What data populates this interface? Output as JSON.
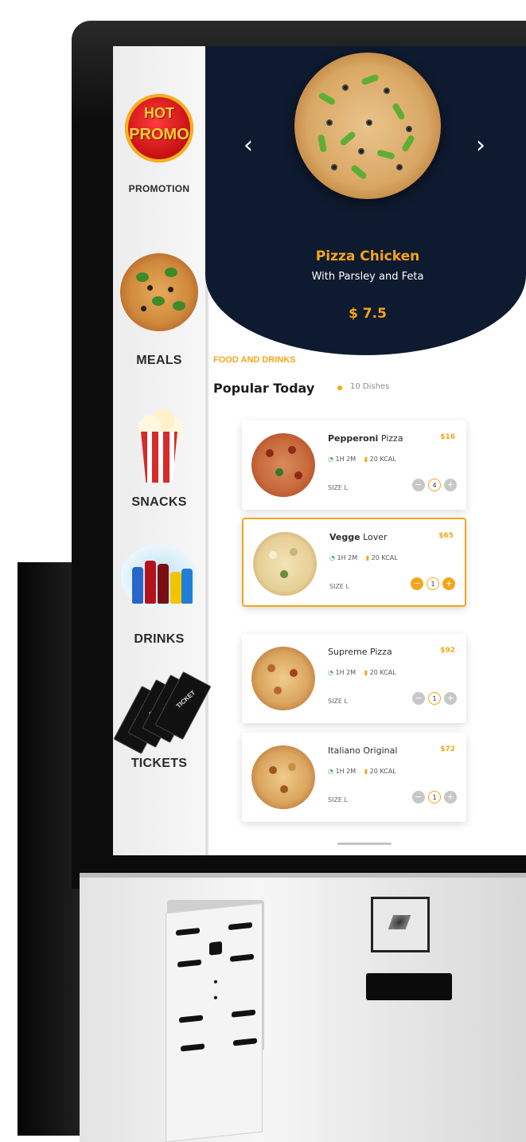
{
  "sidebar": {
    "promo_badge": [
      "HOT",
      "PROMO"
    ],
    "items": [
      {
        "label": "PROMOTION"
      },
      {
        "label": "MEALS"
      },
      {
        "label": "SNACKS"
      },
      {
        "label": "DRINKS"
      },
      {
        "label": "TICKETS"
      }
    ],
    "ticket_text": "TICKET"
  },
  "hero": {
    "title": "Pizza Chicken",
    "subtitle": "With Parsley and Feta",
    "price": "$ 7.5",
    "prev_icon": "‹",
    "next_icon": "›"
  },
  "listing": {
    "eyebrow": "FOOD AND DRINKS",
    "title": "Popular Today",
    "count": "10 Dishes",
    "items": [
      {
        "name_bold": "Pepperoni",
        "name_rest": " Pizza",
        "price": "$16",
        "time": "1H 2M",
        "kcal": "20 KCAL",
        "size": "SIZE L",
        "qty": "4",
        "selected": false
      },
      {
        "name_bold": "Vegge",
        "name_rest": " Lover",
        "price": "$65",
        "time": "1H 2M",
        "kcal": "20 KCAL",
        "size": "SIZE L",
        "qty": "1",
        "selected": true
      },
      {
        "name_bold": "",
        "name_rest": "Supreme Pizza",
        "price": "$92",
        "time": "1H 2M",
        "kcal": "20 KCAL",
        "size": "SIZE L",
        "qty": "1",
        "selected": false
      },
      {
        "name_bold": "",
        "name_rest": "Italiano Original",
        "price": "$72",
        "time": "1H 2M",
        "kcal": "20 KCAL",
        "size": "SIZE L",
        "qty": "1",
        "selected": false
      }
    ]
  },
  "colors": {
    "accent": "#f6a51a",
    "hero_bg": "#0e1a2f",
    "time_icon": "#3aa055"
  },
  "icons": {
    "clock": "clock-icon",
    "calorie": "flame-icon",
    "minus": "−",
    "plus": "+"
  }
}
